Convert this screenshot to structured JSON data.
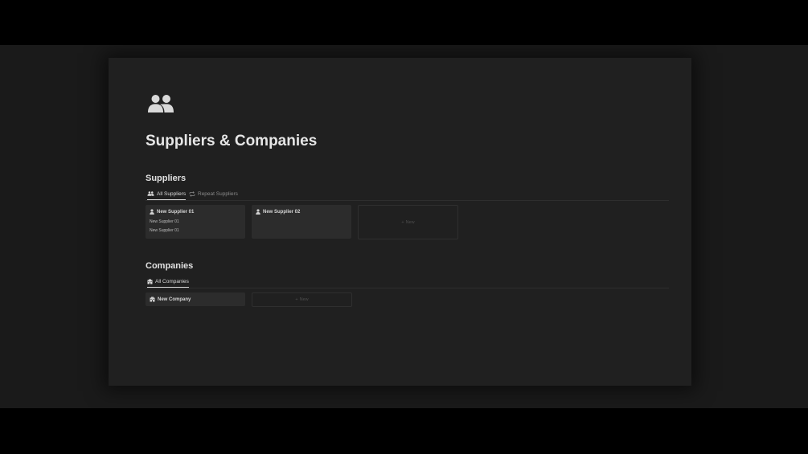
{
  "page": {
    "icon": "people-icon",
    "title": "Suppliers & Companies"
  },
  "suppliers": {
    "heading": "Suppliers",
    "tabs": [
      {
        "label": "All Suppliers",
        "icon": "people-icon",
        "active": true
      },
      {
        "label": "Repeat Suppliers",
        "icon": "repeat-icon",
        "active": false
      }
    ],
    "cards": [
      {
        "title": "New Supplier 01",
        "icon": "person-icon",
        "properties": [
          "New Supplier 01",
          "New Supplier 01"
        ]
      },
      {
        "title": "New Supplier 02",
        "icon": "person-icon",
        "properties": []
      }
    ],
    "new_label": "New"
  },
  "companies": {
    "heading": "Companies",
    "tabs": [
      {
        "label": "All Companies",
        "icon": "building-icon",
        "active": true
      }
    ],
    "cards": [
      {
        "title": "New Company",
        "icon": "building-icon"
      }
    ],
    "new_label": "New"
  },
  "colors": {
    "background": "#000000",
    "workspace": "#1a1a1a",
    "page": "#202020",
    "card": "#2c2c2c",
    "text": "#e6e6e6",
    "muted": "#8a8a8a"
  }
}
